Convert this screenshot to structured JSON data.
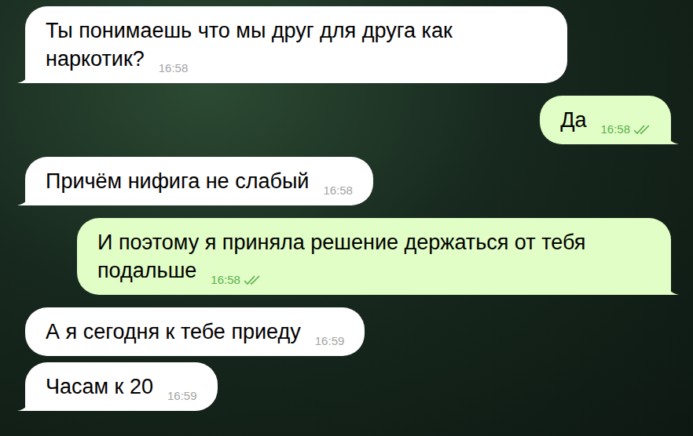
{
  "messages": [
    {
      "kind": "incoming",
      "text": "Ты понимаешь что мы друг для друга как наркотик?",
      "time": "16:58"
    },
    {
      "kind": "outgoing",
      "text": "Да",
      "time": "16:58",
      "read": true
    },
    {
      "kind": "incoming",
      "text": "Причём нифига не слабый",
      "time": "16:58"
    },
    {
      "kind": "outgoing",
      "text": "И поэтому я приняла решение держаться от тебя подальше",
      "time": "16:58",
      "read": true
    },
    {
      "kind": "incoming",
      "text": "А я сегодня к тебе приеду",
      "time": "16:59"
    },
    {
      "kind": "incoming",
      "text": "Часам к 20",
      "time": "16:59"
    }
  ]
}
